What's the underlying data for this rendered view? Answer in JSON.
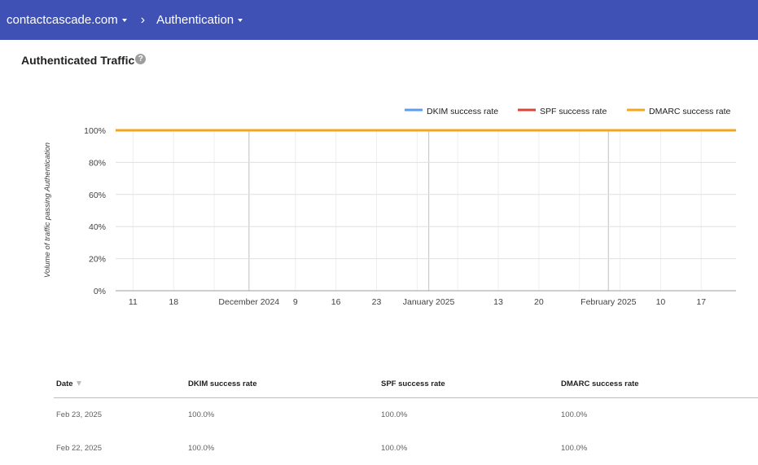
{
  "header": {
    "domain_label": "contactcascade.com",
    "separator": "›",
    "section_label": "Authentication"
  },
  "panel": {
    "title": "Authenticated Traffic",
    "help_icon": "question-mark-icon"
  },
  "chart_data": {
    "type": "line",
    "ylabel": "Volume of traffic passing Authentication",
    "xlabel": "",
    "title": "",
    "ylim": [
      0,
      100
    ],
    "y_ticks": [
      "0%",
      "20%",
      "40%",
      "60%",
      "80%",
      "100%"
    ],
    "x_ticks": [
      "11",
      "18",
      "December 2024",
      "9",
      "16",
      "23",
      "January 2025",
      "13",
      "20",
      "February 2025",
      "10",
      "17"
    ],
    "x_range": [
      "2024-11-08",
      "2025-02-23"
    ],
    "legend_position": "top-right",
    "grid": true,
    "series": [
      {
        "name": "DKIM success rate",
        "color": "#5b9cf0",
        "x": [
          "2024-11-08",
          "2025-02-23"
        ],
        "values": [
          100,
          100
        ]
      },
      {
        "name": "SPF success rate",
        "color": "#db4437",
        "x": [
          "2024-11-08",
          "2025-02-23"
        ],
        "values": [
          100,
          100
        ]
      },
      {
        "name": "DMARC success rate",
        "color": "#f4a71d",
        "x": [
          "2024-11-08",
          "2025-02-23"
        ],
        "values": [
          100,
          100
        ]
      }
    ]
  },
  "table": {
    "columns": [
      "Date",
      "DKIM success rate",
      "SPF success rate",
      "DMARC success rate"
    ],
    "rows": [
      [
        "Feb 23, 2025",
        "100.0%",
        "100.0%",
        "100.0%"
      ],
      [
        "Feb 22, 2025",
        "100.0%",
        "100.0%",
        "100.0%"
      ]
    ]
  }
}
